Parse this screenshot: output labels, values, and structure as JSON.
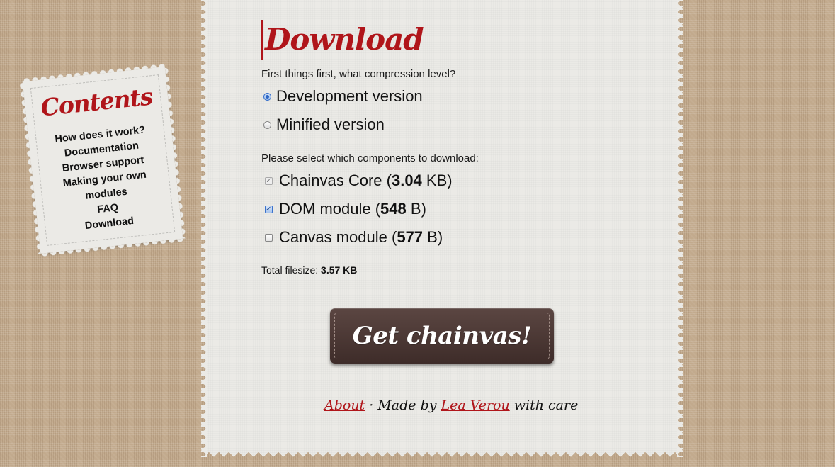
{
  "main": {
    "title": "Download",
    "compression_prompt": "First things first, what compression level?",
    "compression_options": [
      {
        "label": "Development version",
        "selected": true
      },
      {
        "label": "Minified version",
        "selected": false
      }
    ],
    "components_prompt": "Please select which components to download:",
    "components": [
      {
        "name": "Chainvas Core",
        "size": "3.04",
        "unit": "KB",
        "checked": true,
        "disabled": true
      },
      {
        "name": "DOM module",
        "size": "548",
        "unit": "B",
        "checked": true,
        "disabled": false
      },
      {
        "name": "Canvas module",
        "size": "577",
        "unit": "B",
        "checked": false,
        "disabled": false
      }
    ],
    "total_label": "Total filesize:",
    "total_value": "3.57 KB",
    "download_button_label": "Get chainvas!"
  },
  "footer": {
    "about_link": "About",
    "separator": "·",
    "made_by_text": "Made by",
    "author_link": "Lea Verou",
    "with_care_text": "with care"
  },
  "sidebar": {
    "title": "Contents",
    "items": [
      "How does it work?",
      "Documentation",
      "Browser support",
      "Making your own modules",
      "FAQ",
      "Download"
    ]
  },
  "colors": {
    "accent": "#b0151a",
    "button": "#4a3734",
    "paper": "#ebeae6",
    "burlap": "#c2aa8d"
  }
}
